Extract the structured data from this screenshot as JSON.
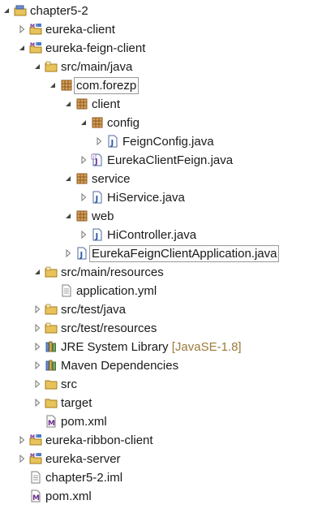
{
  "tree": [
    {
      "label": "chapter5-2",
      "depth": 0,
      "expand": "open",
      "icon": "working-set-icon"
    },
    {
      "label": "eureka-client",
      "depth": 1,
      "expand": "closed",
      "icon": "maven-project-icon"
    },
    {
      "label": "eureka-feign-client",
      "depth": 1,
      "expand": "open",
      "icon": "maven-project-icon"
    },
    {
      "label": "src/main/java",
      "depth": 2,
      "expand": "open",
      "icon": "source-folder-icon"
    },
    {
      "label": "com.forezp",
      "depth": 3,
      "expand": "open",
      "icon": "package-icon",
      "selected": true
    },
    {
      "label": "client",
      "depth": 4,
      "expand": "open",
      "icon": "package-icon"
    },
    {
      "label": "config",
      "depth": 5,
      "expand": "open",
      "icon": "package-icon"
    },
    {
      "label": "FeignConfig.java",
      "depth": 6,
      "expand": "closed",
      "icon": "java-file-icon"
    },
    {
      "label": "EurekaClientFeign.java",
      "depth": 5,
      "expand": "closed",
      "icon": "java-interface-file-icon"
    },
    {
      "label": "service",
      "depth": 4,
      "expand": "open",
      "icon": "package-icon"
    },
    {
      "label": "HiService.java",
      "depth": 5,
      "expand": "closed",
      "icon": "java-file-icon"
    },
    {
      "label": "web",
      "depth": 4,
      "expand": "open",
      "icon": "package-icon"
    },
    {
      "label": "HiController.java",
      "depth": 5,
      "expand": "closed",
      "icon": "java-file-icon"
    },
    {
      "label": "EurekaFeignClientApplication.java",
      "depth": 4,
      "expand": "closed",
      "icon": "java-file-icon",
      "selected": true
    },
    {
      "label": "src/main/resources",
      "depth": 2,
      "expand": "open",
      "icon": "source-folder-icon"
    },
    {
      "label": "application.yml",
      "depth": 3,
      "expand": "none",
      "icon": "text-file-icon"
    },
    {
      "label": "src/test/java",
      "depth": 2,
      "expand": "closed",
      "icon": "source-folder-icon"
    },
    {
      "label": "src/test/resources",
      "depth": 2,
      "expand": "closed",
      "icon": "source-folder-icon"
    },
    {
      "label": "JRE System Library",
      "decor": "[JavaSE-1.8]",
      "depth": 2,
      "expand": "closed",
      "icon": "library-icon"
    },
    {
      "label": "Maven Dependencies",
      "depth": 2,
      "expand": "closed",
      "icon": "library-icon"
    },
    {
      "label": "src",
      "depth": 2,
      "expand": "closed",
      "icon": "folder-icon"
    },
    {
      "label": "target",
      "depth": 2,
      "expand": "closed",
      "icon": "folder-icon"
    },
    {
      "label": "pom.xml",
      "depth": 2,
      "expand": "none",
      "icon": "maven-pom-icon"
    },
    {
      "label": "eureka-ribbon-client",
      "depth": 1,
      "expand": "closed",
      "icon": "maven-project-icon"
    },
    {
      "label": "eureka-server",
      "depth": 1,
      "expand": "closed",
      "icon": "maven-project-icon"
    },
    {
      "label": "chapter5-2.iml",
      "depth": 1,
      "expand": "none",
      "icon": "text-file-icon"
    },
    {
      "label": "pom.xml",
      "depth": 1,
      "expand": "none",
      "icon": "maven-pom-icon"
    }
  ]
}
